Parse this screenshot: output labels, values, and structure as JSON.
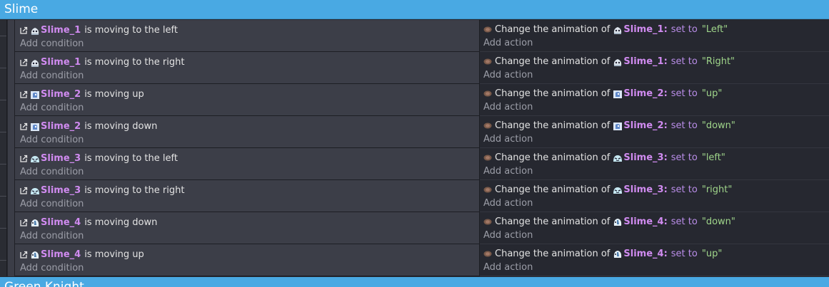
{
  "group": {
    "title": "Slime",
    "next_title": "Green Knight"
  },
  "labels": {
    "add_condition": "Add condition",
    "add_action": "Add action"
  },
  "colors": {
    "header": "#49a9e3",
    "object_name": "#d08bf0",
    "value": "#9fd58a",
    "operator": "#b98de8"
  },
  "events": [
    {
      "object": "Slime_1",
      "icon": "slime-white-icon",
      "condition": "is moving to the left",
      "action_text": "Change the animation of",
      "action_object": "Slime_1",
      "operator": "set to",
      "value": "\"Left\""
    },
    {
      "object": "Slime_1",
      "icon": "slime-white-icon",
      "condition": "is moving to the right",
      "action_text": "Change the animation of",
      "action_object": "Slime_1",
      "operator": "set to",
      "value": "\"Right\""
    },
    {
      "object": "Slime_2",
      "icon": "slime-blue-icon",
      "condition": "is moving up",
      "action_text": "Change the animation of",
      "action_object": "Slime_2",
      "operator": "set to",
      "value": "\"up\""
    },
    {
      "object": "Slime_2",
      "icon": "slime-blue-icon",
      "condition": "is moving down",
      "action_text": "Change the animation of",
      "action_object": "Slime_2",
      "operator": "set to",
      "value": "\"down\""
    },
    {
      "object": "Slime_3",
      "icon": "slime-cyan-icon",
      "condition": "is moving to the left",
      "action_text": "Change the animation of",
      "action_object": "Slime_3",
      "operator": "set to",
      "value": "\"left\""
    },
    {
      "object": "Slime_3",
      "icon": "slime-cyan-icon",
      "condition": "is moving to the right",
      "action_text": "Change the animation of",
      "action_object": "Slime_3",
      "operator": "set to",
      "value": "\"right\""
    },
    {
      "object": "Slime_4",
      "icon": "slime-ice-icon",
      "condition": "is moving down",
      "action_text": "Change the animation of",
      "action_object": "Slime_4",
      "operator": "set to",
      "value": "\"down\""
    },
    {
      "object": "Slime_4",
      "icon": "slime-ice-icon",
      "condition": "is moving up",
      "action_text": "Change the animation of",
      "action_object": "Slime_4",
      "operator": "set to",
      "value": "\"up\""
    }
  ]
}
